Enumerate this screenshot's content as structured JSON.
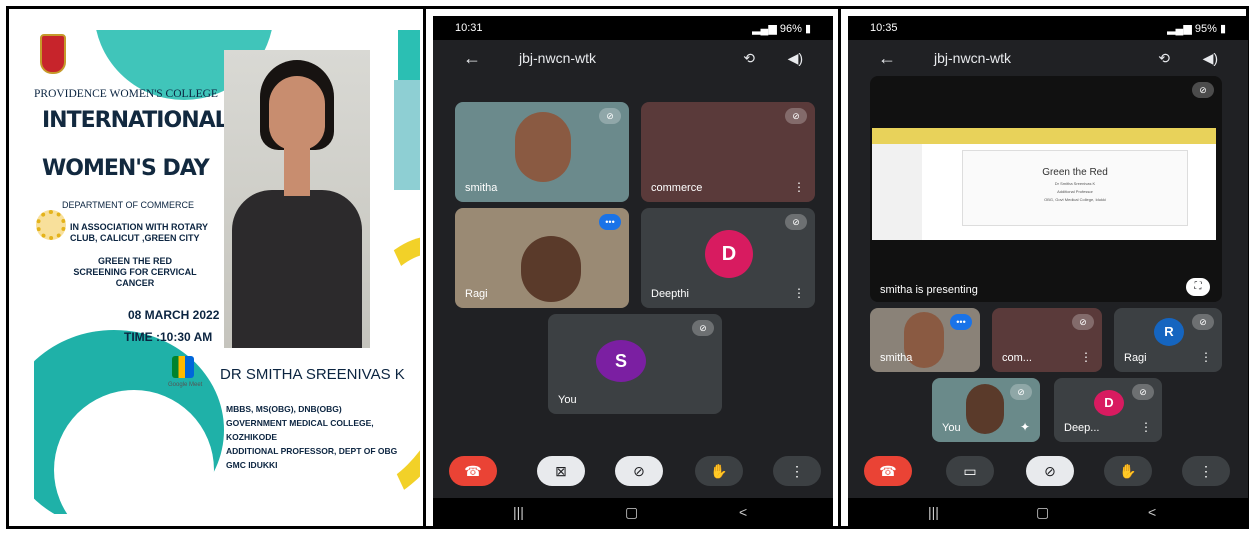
{
  "poster": {
    "college": "PROVIDENCE WOMEN'S COLLEGE",
    "title_line1": "INTERNATIONAL",
    "title_line2": "WOMEN'S DAY",
    "department": "DEPARTMENT OF COMMERCE",
    "association": "IN ASSOCIATION WITH ROTARY CLUB, CALICUT ,GREEN CITY",
    "topic": "GREEN THE RED SCREENING FOR CERVICAL CANCER",
    "date": "08 MARCH 2022",
    "time": "TIME :10:30 AM",
    "meet_label": "Google Meet",
    "speaker_name": "DR SMITHA SREENIVAS K",
    "quals": [
      "MBBS, MS(OBG), DNB(OBG)",
      "GOVERNMENT MEDICAL COLLEGE, KOZHIKODE",
      "ADDITIONAL PROFESSOR, DEPT OF OBG",
      "GMC IDUKKI"
    ]
  },
  "phone1": {
    "time": "10:31",
    "battery": "96%",
    "meeting_id": "jbj-nwcn-wtk",
    "tiles": [
      {
        "name": "smitha"
      },
      {
        "name": "commerce"
      },
      {
        "name": "Ragi"
      },
      {
        "name": "Deepthi",
        "initial": "D"
      },
      {
        "name": "You",
        "initial": "S"
      }
    ]
  },
  "phone2": {
    "time": "10:35",
    "battery": "95%",
    "meeting_id": "jbj-nwcn-wtk",
    "slide_title": "Green the Red",
    "slide_sub": "Dr Smitha Sreenivas K",
    "slide_sub2": "Additional Professor",
    "slide_sub3": "OBG, Govt Medical College, Idukki",
    "presenting": "smitha is presenting",
    "tiles": [
      {
        "name": "smitha"
      },
      {
        "name": "com..."
      },
      {
        "name": "Ragi",
        "initial": "R"
      },
      {
        "name": "You"
      },
      {
        "name": "Deep...",
        "initial": "D"
      }
    ]
  },
  "colors": {
    "avatar_purple": "#7b1fa2",
    "avatar_red": "#d81b60",
    "avatar_blue": "#1565c0",
    "end_call": "#ea4335"
  }
}
